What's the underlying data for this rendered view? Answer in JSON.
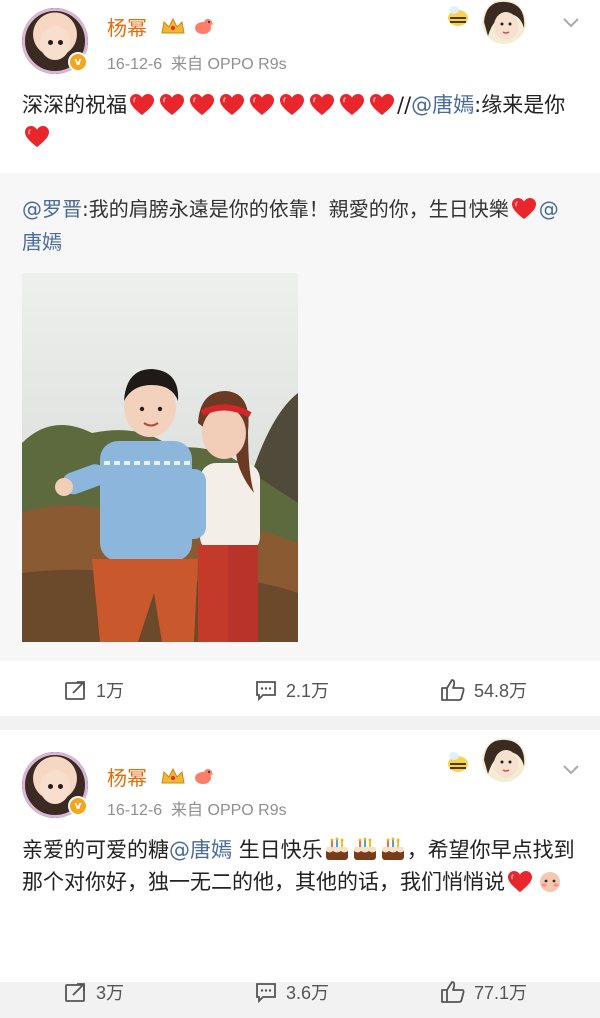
{
  "posts": [
    {
      "username": "杨幂",
      "timestamp": "16-12-6",
      "source": "来自 OPPO R9s",
      "text_prefix": "深深的祝福",
      "text_sep": "//",
      "mention1": "@唐嫣",
      "text_suffix": ":缘来是你",
      "repost": {
        "mention_author": "@罗晋",
        "text": ":我的肩膀永遠是你的依靠！親愛的你，生日快樂",
        "mention_tail": "@唐嫣"
      },
      "actions": {
        "repost": "1万",
        "comment": "2.1万",
        "like": "54.8万"
      }
    },
    {
      "username": "杨幂",
      "timestamp": "16-12-6",
      "source": "来自 OPPO R9s",
      "text_a": "亲爱的可爱的糖",
      "mention": "@唐嫣",
      "text_b": "生日快乐",
      "text_c": "，希望你早点找到那个对你好，独一无二的他，其他的话，我们悄悄说",
      "actions": {
        "repost": "3万",
        "comment": "3.6万",
        "like": "77.1万"
      }
    }
  ],
  "colors": {
    "username": "#e86b0a",
    "mention": "#4a6a9b",
    "meta": "#8f8f8f",
    "heart": "#e8262c"
  },
  "icons": [
    "crown-icon",
    "bird-icon",
    "heart-icon",
    "cake-icon",
    "repost-icon",
    "comment-icon",
    "like-icon",
    "chevron-down-icon"
  ]
}
